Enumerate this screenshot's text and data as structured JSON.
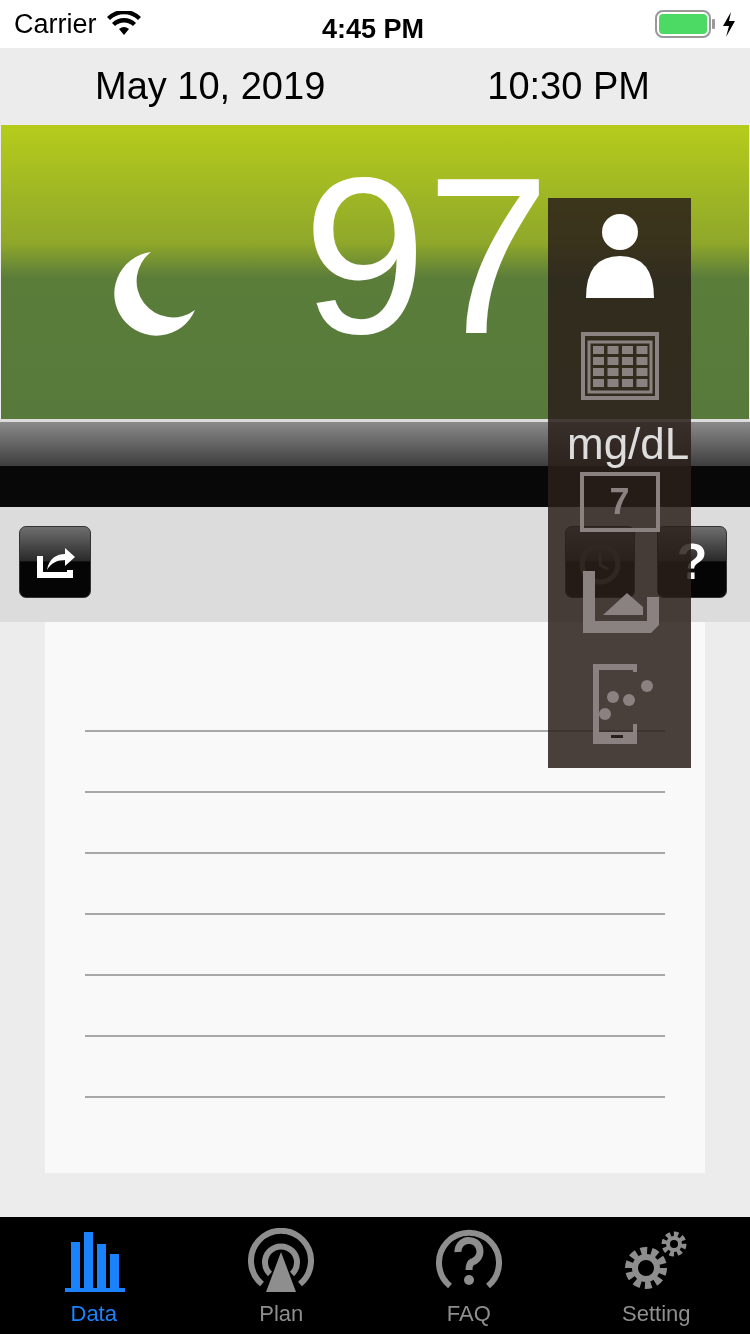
{
  "status_bar": {
    "carrier": "Carrier",
    "time": "4:45 PM"
  },
  "header": {
    "date": "May 10, 2019",
    "time": "10:30 PM"
  },
  "reading": {
    "value": "97",
    "unit": "mg/dL",
    "night": true
  },
  "toolbar": [
    {
      "kind": "share"
    },
    {
      "kind": "history"
    },
    {
      "kind": "help",
      "label": "?"
    }
  ],
  "overlay_menu": [
    {
      "kind": "person",
      "selected": true
    },
    {
      "kind": "grid",
      "selected": false
    },
    {
      "kind": "calendar",
      "label": "7",
      "selected": false
    },
    {
      "kind": "document",
      "selected": false
    },
    {
      "kind": "phone",
      "selected": false
    }
  ],
  "tab_bar": [
    {
      "label": "Data",
      "kind": "chart",
      "selected": true
    },
    {
      "label": "Plan",
      "kind": "signal",
      "selected": false
    },
    {
      "label": "FAQ",
      "kind": "help",
      "selected": false
    },
    {
      "label": "Setting",
      "kind": "gears",
      "selected": false
    }
  ]
}
